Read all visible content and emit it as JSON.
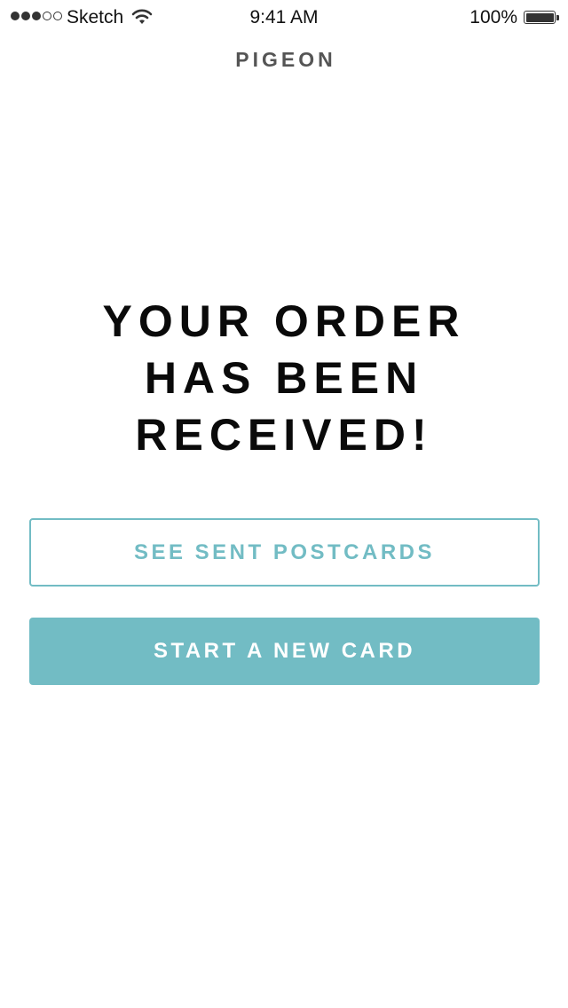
{
  "status_bar": {
    "carrier": "Sketch",
    "time": "9:41 AM",
    "battery": "100%",
    "signal_strength": {
      "filled": 3,
      "total": 5
    },
    "icons": [
      "signal-dots-icon",
      "wifi-icon",
      "battery-icon"
    ]
  },
  "header": {
    "title": "PIGEON"
  },
  "confirmation": {
    "lines": [
      "YOUR ORDER",
      "HAS BEEN",
      "RECEIVED!"
    ]
  },
  "actions": {
    "see_sent_label": "SEE SENT POSTCARDS",
    "start_new_label": "START A NEW CARD"
  },
  "colors": {
    "accent": "#72bcc4",
    "title": "#555555",
    "headline": "#0a0a0a"
  }
}
